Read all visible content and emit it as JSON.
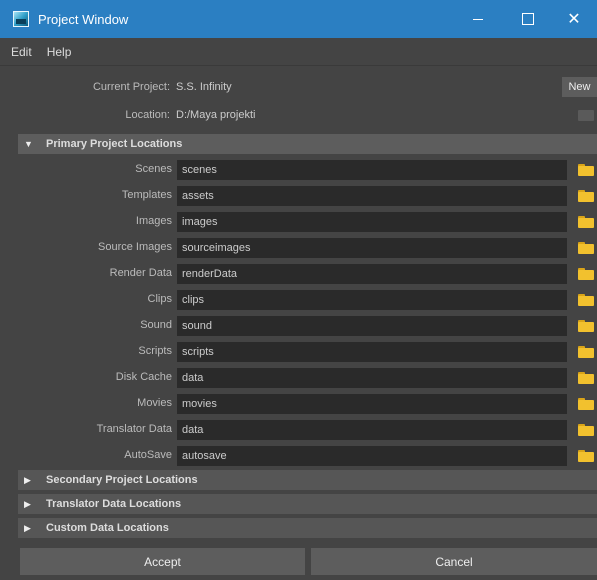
{
  "window": {
    "title": "Project Window",
    "minimize": "—",
    "close": "✕"
  },
  "menu": [
    "Edit",
    "Help"
  ],
  "project": {
    "current_label": "Current Project:",
    "current_value": "S.S. Infinity",
    "new_button": "New",
    "location_label": "Location:",
    "location_value": "D:/Maya projekti"
  },
  "sections": {
    "primary": "Primary Project Locations",
    "secondary": "Secondary Project Locations",
    "translator": "Translator Data Locations",
    "custom": "Custom Data Locations"
  },
  "locations": [
    {
      "label": "Scenes",
      "value": "scenes"
    },
    {
      "label": "Templates",
      "value": "assets"
    },
    {
      "label": "Images",
      "value": "images"
    },
    {
      "label": "Source Images",
      "value": "sourceimages"
    },
    {
      "label": "Render Data",
      "value": "renderData"
    },
    {
      "label": "Clips",
      "value": "clips"
    },
    {
      "label": "Sound",
      "value": "sound"
    },
    {
      "label": "Scripts",
      "value": "scripts"
    },
    {
      "label": "Disk Cache",
      "value": "data"
    },
    {
      "label": "Movies",
      "value": "movies"
    },
    {
      "label": "Translator Data",
      "value": "data"
    },
    {
      "label": "AutoSave",
      "value": "autosave"
    }
  ],
  "buttons": {
    "accept": "Accept",
    "cancel": "Cancel"
  }
}
